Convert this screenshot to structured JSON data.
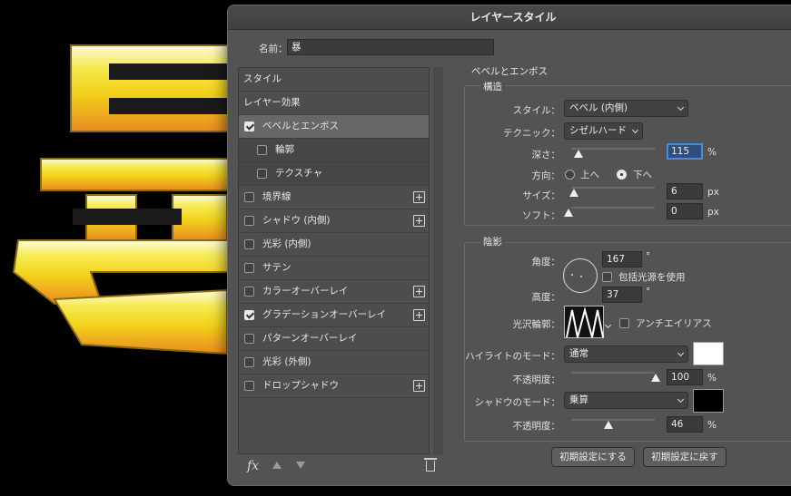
{
  "dialog": {
    "title": "レイヤースタイル"
  },
  "name_field": {
    "label": "名前：",
    "value": "暴"
  },
  "style_list": {
    "items": [
      {
        "label": "スタイル",
        "kind": "header",
        "checked": false,
        "plus": false,
        "selected": false
      },
      {
        "label": "レイヤー効果",
        "kind": "header",
        "checked": false,
        "plus": false,
        "selected": false
      },
      {
        "label": "ベベルとエンボス",
        "kind": "item",
        "checked": true,
        "plus": false,
        "selected": true
      },
      {
        "label": "輪郭",
        "kind": "child",
        "checked": false,
        "plus": false,
        "selected": false
      },
      {
        "label": "テクスチャ",
        "kind": "child",
        "checked": false,
        "plus": false,
        "selected": false
      },
      {
        "label": "境界線",
        "kind": "item",
        "checked": false,
        "plus": true,
        "selected": false
      },
      {
        "label": "シャドウ (内側)",
        "kind": "item",
        "checked": false,
        "plus": true,
        "selected": false
      },
      {
        "label": "光彩 (内側)",
        "kind": "item",
        "checked": false,
        "plus": false,
        "selected": false
      },
      {
        "label": "サテン",
        "kind": "item",
        "checked": false,
        "plus": false,
        "selected": false
      },
      {
        "label": "カラーオーバーレイ",
        "kind": "item",
        "checked": false,
        "plus": true,
        "selected": false
      },
      {
        "label": "グラデーションオーバーレイ",
        "kind": "item",
        "checked": true,
        "plus": true,
        "selected": false
      },
      {
        "label": "パターンオーバーレイ",
        "kind": "item",
        "checked": false,
        "plus": false,
        "selected": false
      },
      {
        "label": "光彩 (外側)",
        "kind": "item",
        "checked": false,
        "plus": false,
        "selected": false
      },
      {
        "label": "ドロップシャドウ",
        "kind": "item",
        "checked": false,
        "plus": true,
        "selected": false
      }
    ],
    "fx_label": "fx"
  },
  "bevel": {
    "section_title": "ベベルとエンボス",
    "structure": {
      "title": "構造",
      "style_label": "スタイル：",
      "style_value": "ベベル (内側)",
      "technique_label": "テクニック：",
      "technique_value": "シゼルハード",
      "depth_label": "深さ：",
      "depth_value": "115",
      "depth_unit": "%",
      "direction_label": "方向：",
      "direction_up": "上へ",
      "direction_down": "下へ",
      "direction_selected": "下へ",
      "size_label": "サイズ：",
      "size_value": "6",
      "size_unit": "px",
      "soften_label": "ソフト：",
      "soften_value": "0",
      "soften_unit": "px"
    },
    "shading": {
      "title": "陰影",
      "angle_label": "角度：",
      "angle_value": "167",
      "angle_unit": "°",
      "global_light_label": "包括光源を使用",
      "altitude_label": "高度：",
      "altitude_value": "37",
      "altitude_unit": "°",
      "gloss_contour_label": "光沢輪郭：",
      "antialias_label": "アンチエイリアス",
      "highlight_mode_label": "ハイライトのモード：",
      "highlight_mode_value": "通常",
      "highlight_color": "#ffffff",
      "highlight_opacity_label": "不透明度：",
      "highlight_opacity_value": "100",
      "highlight_opacity_unit": "%",
      "shadow_mode_label": "シャドウのモード：",
      "shadow_mode_value": "乗算",
      "shadow_color": "#000000",
      "shadow_opacity_label": "不透明度：",
      "shadow_opacity_value": "46",
      "shadow_opacity_unit": "%"
    },
    "make_default": "初期設定にする",
    "reset_default": "初期設定に戻す"
  },
  "colors": {
    "dialog_bg": "#535353",
    "focus": "#4a8ad8",
    "gold_top": "#f7f3c0",
    "gold_mid": "#f2d21a",
    "gold_bottom": "#e88a20"
  }
}
